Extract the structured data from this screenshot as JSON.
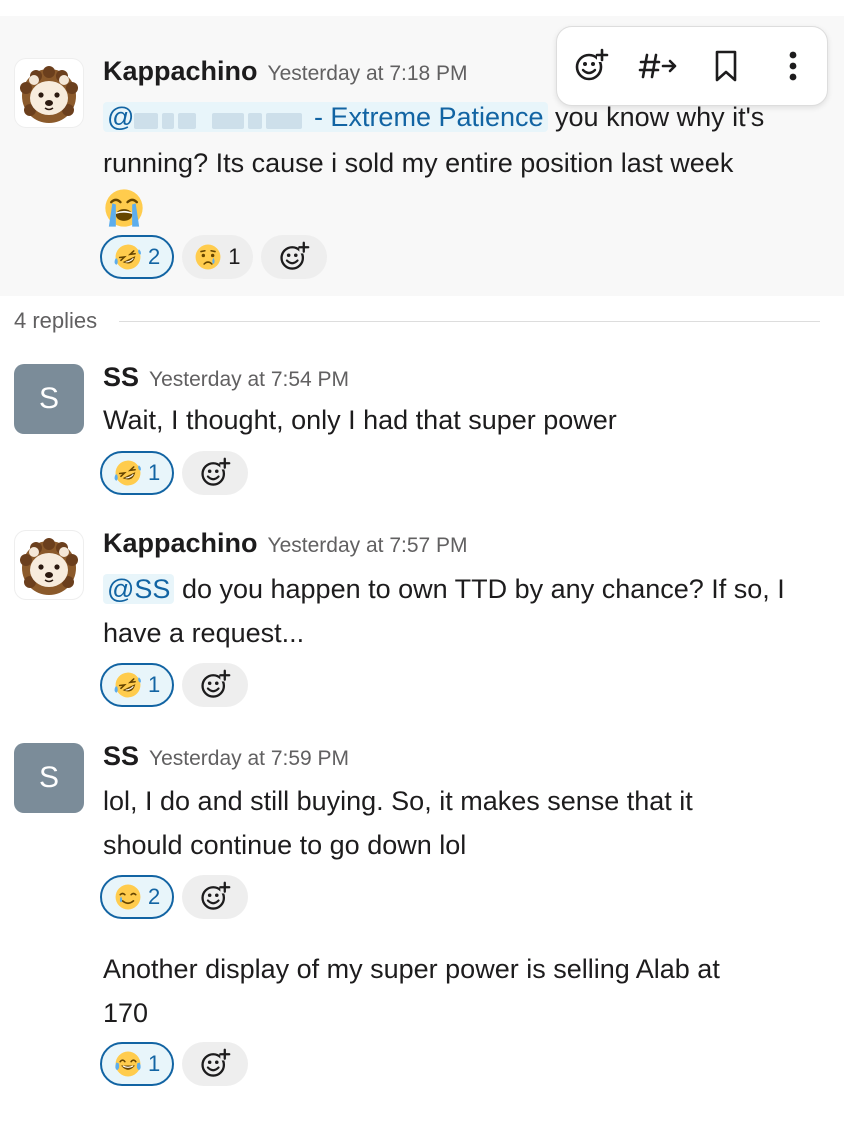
{
  "toolbar": {
    "icons": [
      "add-reaction-icon",
      "reply-in-thread-icon",
      "save-bookmark-icon",
      "more-actions-icon"
    ]
  },
  "parent_message": {
    "author": "Kappachino",
    "time": "Yesterday at 7:18 PM",
    "mention_prefix": "@",
    "mention_suffix": "- Extreme Patience",
    "text_line1": " you know why it's",
    "text_line2": "running? Its cause i sold my entire position last week",
    "emoji": "sob",
    "reactions": [
      {
        "emoji": "rolling-on-floor-laughing",
        "count": "2",
        "mine": true
      },
      {
        "emoji": "crying-face",
        "count": "1",
        "mine": false
      }
    ]
  },
  "thread": {
    "replies_label": "4 replies"
  },
  "replies": [
    {
      "author": "SS",
      "avatar_letter": "S",
      "time": "Yesterday at 7:54 PM",
      "text": "Wait, I thought, only I had that super power",
      "reactions": [
        {
          "emoji": "rolling-on-floor-laughing",
          "count": "1",
          "mine": true
        }
      ]
    },
    {
      "author": "Kappachino",
      "time": "Yesterday at 7:57 PM",
      "mention": "@SS",
      "text_line1": " do you happen to own TTD by any chance? If so, I",
      "text_line2": "have a request...",
      "reactions": [
        {
          "emoji": "rolling-on-floor-laughing",
          "count": "1",
          "mine": true
        }
      ]
    },
    {
      "author": "SS",
      "avatar_letter": "S",
      "time": "Yesterday at 7:59 PM",
      "text_line1": "lol, I do and still buying. So, it makes sense that it",
      "text_line2": "should continue to go down lol",
      "reactions": [
        {
          "emoji": "smiling-face-with-tear",
          "count": "2",
          "mine": true
        }
      ],
      "followup_line1": "Another display of my super power is selling Alab at",
      "followup_line2": "170",
      "followup_reactions": [
        {
          "emoji": "face-with-tears-of-joy",
          "count": "1",
          "mine": true
        }
      ]
    }
  ],
  "colors": {
    "accent": "#1264a3",
    "mention_bg": "#e8f5fa",
    "avatar_s": "#7b8c99",
    "highlight_bg": "#f8f8f8",
    "emoji_yellow": "#ffcc4d",
    "tear_blue": "#5dadec"
  }
}
